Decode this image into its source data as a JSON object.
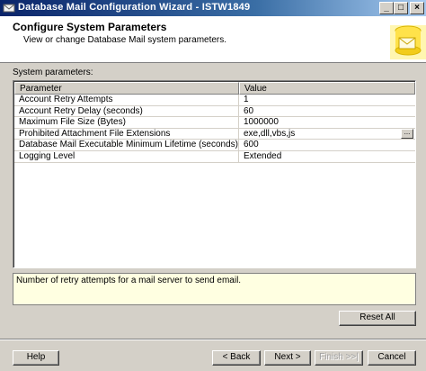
{
  "window": {
    "title": "Database Mail Configuration Wizard - ISTW1849",
    "minimize_glyph": "_",
    "maximize_glyph": "□",
    "close_glyph": "×"
  },
  "header": {
    "title": "Configure System Parameters",
    "subtitle": "View or change Database Mail system parameters."
  },
  "section_label": "System parameters:",
  "grid": {
    "columns": [
      "Parameter",
      "Value"
    ],
    "rows": [
      {
        "parameter": "Account Retry Attempts",
        "value": "1"
      },
      {
        "parameter": "Account Retry Delay (seconds)",
        "value": "60"
      },
      {
        "parameter": "Maximum File Size (Bytes)",
        "value": "1000000"
      },
      {
        "parameter": "Prohibited Attachment File Extensions",
        "value": "exe,dll,vbs,js"
      },
      {
        "parameter": "Database Mail Executable Minimum Lifetime (seconds)",
        "value": "600"
      },
      {
        "parameter": "Logging Level",
        "value": "Extended"
      }
    ],
    "ellipsis_label": "..."
  },
  "description": "Number of retry attempts for a mail server to send email.",
  "buttons": {
    "reset_all": "Reset All",
    "help": "Help",
    "back": "< Back",
    "next": "Next >",
    "finish": "Finish >>|",
    "cancel": "Cancel"
  },
  "colors": {
    "titlebar": "#0a246a",
    "description_background": "#ffffe1",
    "dialog_background": "#d4d0c8"
  }
}
